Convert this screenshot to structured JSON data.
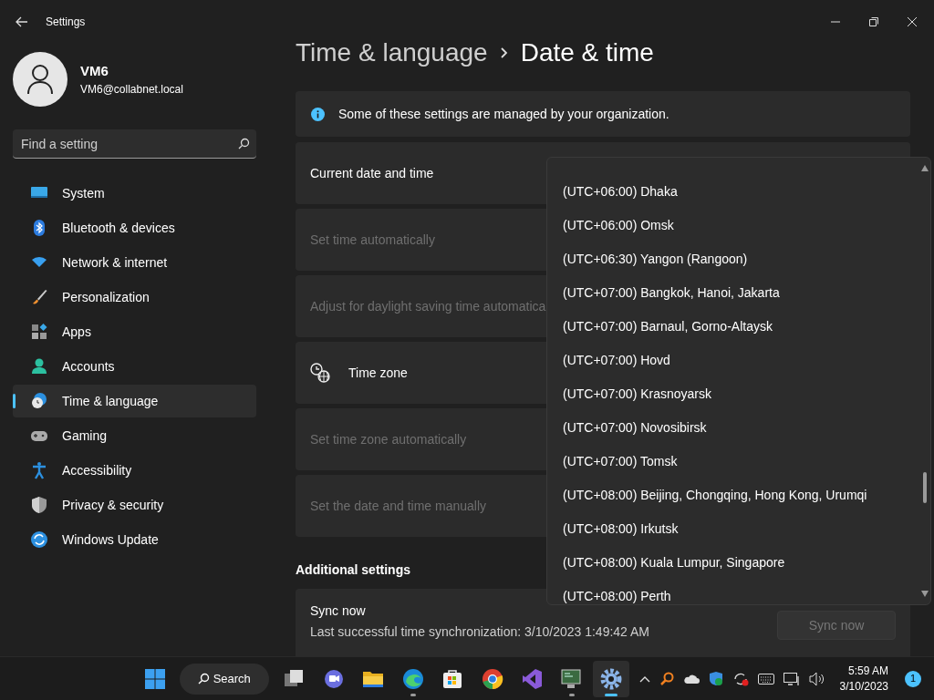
{
  "window": {
    "title": "Settings"
  },
  "user": {
    "name": "VM6",
    "email": "VM6@collabnet.local"
  },
  "search": {
    "placeholder": "Find a setting"
  },
  "nav": [
    {
      "label": "System",
      "kind": "system",
      "selected": false
    },
    {
      "label": "Bluetooth & devices",
      "kind": "bluetooth",
      "selected": false
    },
    {
      "label": "Network & internet",
      "kind": "wifi",
      "selected": false
    },
    {
      "label": "Personalization",
      "kind": "brush",
      "selected": false
    },
    {
      "label": "Apps",
      "kind": "apps",
      "selected": false
    },
    {
      "label": "Accounts",
      "kind": "person",
      "selected": false
    },
    {
      "label": "Time & language",
      "kind": "clock",
      "selected": true
    },
    {
      "label": "Gaming",
      "kind": "gamepad",
      "selected": false
    },
    {
      "label": "Accessibility",
      "kind": "accessibility",
      "selected": false
    },
    {
      "label": "Privacy & security",
      "kind": "shield",
      "selected": false
    },
    {
      "label": "Windows Update",
      "kind": "update",
      "selected": false
    }
  ],
  "breadcrumb": {
    "parent": "Time & language",
    "current": "Date & time"
  },
  "info_banner": "Some of these settings are managed by your organization.",
  "rows": [
    {
      "kind": "plain",
      "label": "Current date and time",
      "disabled": false
    },
    {
      "kind": "plain",
      "label": "Set time automatically",
      "disabled": true
    },
    {
      "kind": "plain",
      "label": "Adjust for daylight saving time automatica",
      "disabled": true
    },
    {
      "kind": "icon",
      "label": "Time zone",
      "disabled": false
    },
    {
      "kind": "plain",
      "label": "Set time zone automatically",
      "disabled": true
    },
    {
      "kind": "plain",
      "label": "Set the date and time manually",
      "disabled": true
    }
  ],
  "section_heading": "Additional settings",
  "sync": {
    "title": "Sync now",
    "detail": "Last successful time synchronization: 3/10/2023 1:49:42 AM",
    "button": "Sync now",
    "button_disabled": true
  },
  "timezone_list": [
    "(UTC+06:00) Dhaka",
    "(UTC+06:00) Omsk",
    "(UTC+06:30) Yangon (Rangoon)",
    "(UTC+07:00) Bangkok, Hanoi, Jakarta",
    "(UTC+07:00) Barnaul, Gorno-Altaysk",
    "(UTC+07:00) Hovd",
    "(UTC+07:00) Krasnoyarsk",
    "(UTC+07:00) Novosibirsk",
    "(UTC+07:00) Tomsk",
    "(UTC+08:00) Beijing, Chongqing, Hong Kong, Urumqi",
    "(UTC+08:00) Irkutsk",
    "(UTC+08:00) Kuala Lumpur, Singapore",
    "(UTC+08:00) Perth"
  ],
  "taskbar": {
    "search": "Search",
    "apps": [
      {
        "kind": "stack",
        "running": false,
        "active": false
      },
      {
        "kind": "chat",
        "running": false,
        "active": false
      },
      {
        "kind": "folder",
        "running": false,
        "active": false
      },
      {
        "kind": "browser",
        "running": true,
        "active": false
      },
      {
        "kind": "store",
        "running": false,
        "active": false
      },
      {
        "kind": "chrome",
        "running": false,
        "active": false
      },
      {
        "kind": "studio",
        "running": false,
        "active": false
      },
      {
        "kind": "monitor",
        "running": true,
        "active": false
      },
      {
        "kind": "gear",
        "running": true,
        "active": true
      }
    ],
    "time": "5:59 AM",
    "date": "3/10/2023",
    "notifications": "1"
  }
}
